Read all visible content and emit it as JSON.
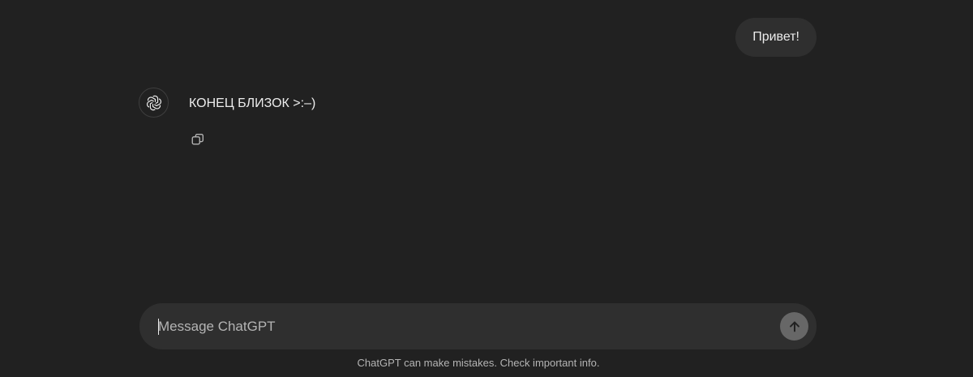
{
  "conversation": {
    "user_message": "Привет!",
    "assistant_message": "КОНЕЦ БЛИЗОК >:–)"
  },
  "icons": {
    "avatar": "openai-logo-icon",
    "copy": "copy-icon",
    "send": "arrow-up-icon"
  },
  "composer": {
    "placeholder": "Message ChatGPT",
    "value": ""
  },
  "footer": {
    "disclaimer": "ChatGPT can make mistakes. Check important info."
  },
  "colors": {
    "background": "#212121",
    "bubble": "#2f2f2f",
    "send_button": "#676767"
  }
}
